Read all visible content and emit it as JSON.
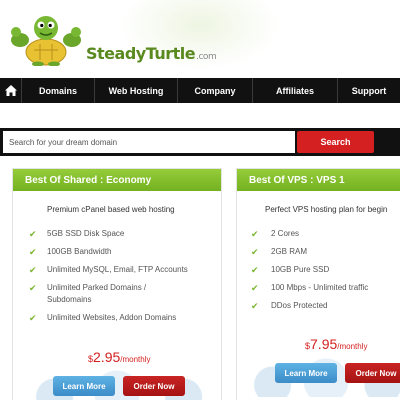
{
  "brand": {
    "name": "SteadyTurtle",
    "tld": ".com"
  },
  "nav": {
    "items": [
      {
        "label": "Domains"
      },
      {
        "label": "Web Hosting"
      },
      {
        "label": "Company"
      },
      {
        "label": "Affiliates"
      },
      {
        "label": "Support"
      }
    ]
  },
  "search": {
    "placeholder": "Search for your dream domain",
    "button_label": "Search"
  },
  "plans": [
    {
      "title": "Best Of Shared : Economy",
      "subtitle": "Premium cPanel based web hosting",
      "features": [
        "5GB SSD Disk Space",
        "100GB Bandwidth",
        "Unlimited MySQL, Email, FTP Accounts",
        "Unlimited Parked Domains / Subdomains",
        "Unlimited Websites, Addon Domains"
      ],
      "price_currency": "$",
      "price": "2.95",
      "price_period": "/monthly",
      "learn_more_label": "Learn More",
      "order_label": "Order Now"
    },
    {
      "title": "Best Of VPS : VPS 1",
      "subtitle": "Perfect VPS hosting plan for begin",
      "features": [
        "2 Cores",
        "2GB RAM",
        "10GB Pure SSD",
        "100 Mbps - Unlimited traffic",
        "DDos Protected"
      ],
      "price_currency": "$",
      "price": "7.95",
      "price_period": "/monthly",
      "learn_more_label": "Learn More",
      "order_label": "Order Now"
    }
  ],
  "colors": {
    "accent_green": "#7ab52d",
    "order_red": "#d42020",
    "learn_blue": "#3b8cc8",
    "nav_bg": "#111111"
  },
  "icons": {
    "home": "home-icon",
    "check": "check-icon",
    "logo": "turtle-mascot-logo"
  }
}
